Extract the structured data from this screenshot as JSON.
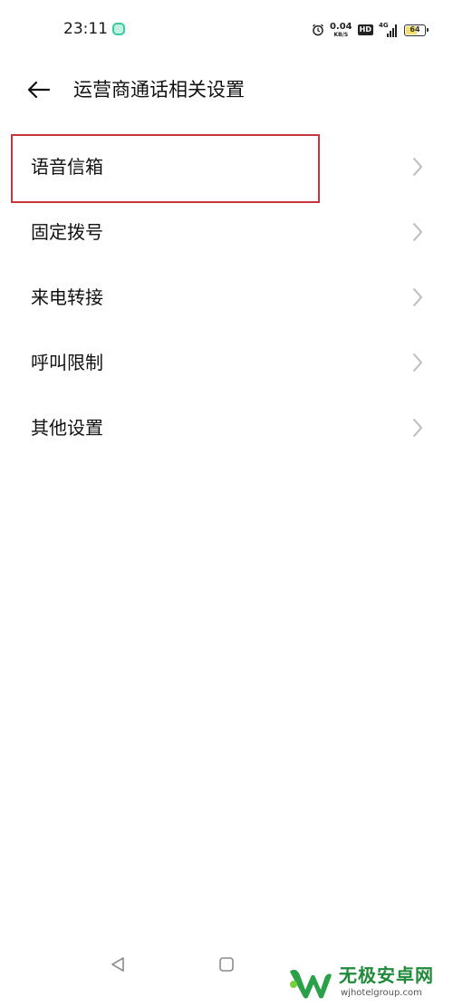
{
  "status_bar": {
    "time": "23:11",
    "speed_value": "0.04",
    "speed_unit": "KB/S",
    "hd_label": "HD",
    "network_label": "4G",
    "battery_level": "64",
    "battery_fraction": 0.64,
    "icons": [
      "app-notification-icon",
      "alarm-icon",
      "signal-icon",
      "battery-icon"
    ]
  },
  "header": {
    "title": "运营商通话相关设置",
    "back_icon": "arrow-left-icon"
  },
  "menu": {
    "items": [
      {
        "label": "语音信箱"
      },
      {
        "label": "固定拨号"
      },
      {
        "label": "来电转接"
      },
      {
        "label": "呼叫限制"
      },
      {
        "label": "其他设置"
      }
    ],
    "chevron_icon": "chevron-right-icon",
    "highlighted_index": 2,
    "highlight_color": "#c8363d"
  },
  "nav_bar": {
    "icons": [
      "nav-back-triangle-icon",
      "nav-home-square-icon"
    ]
  },
  "watermark": {
    "title": "无极安卓网",
    "url": "wjhotelgroup.com",
    "brand_color": "#1f8a3a"
  }
}
